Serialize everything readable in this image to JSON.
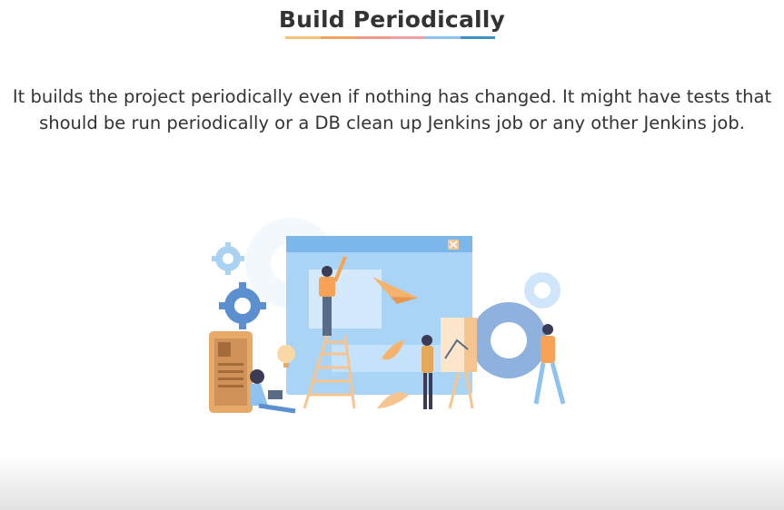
{
  "slide": {
    "title": "Build Periodically",
    "body": "It builds the project periodically even if nothing has changed. It might have tests that should be run periodically or a DB clean up Jenkins job or any other Jenkins job."
  },
  "colors": {
    "title_text": "#333333",
    "underline": [
      "#f4b183",
      "#f4a261",
      "#e9967a",
      "#f08080",
      "#7fb3d5",
      "#4a90c2"
    ],
    "illustration_primary": "#8fc3ef",
    "illustration_accent": "#f6a04d"
  },
  "illustration": {
    "icon": "team-building-website-illustration"
  }
}
